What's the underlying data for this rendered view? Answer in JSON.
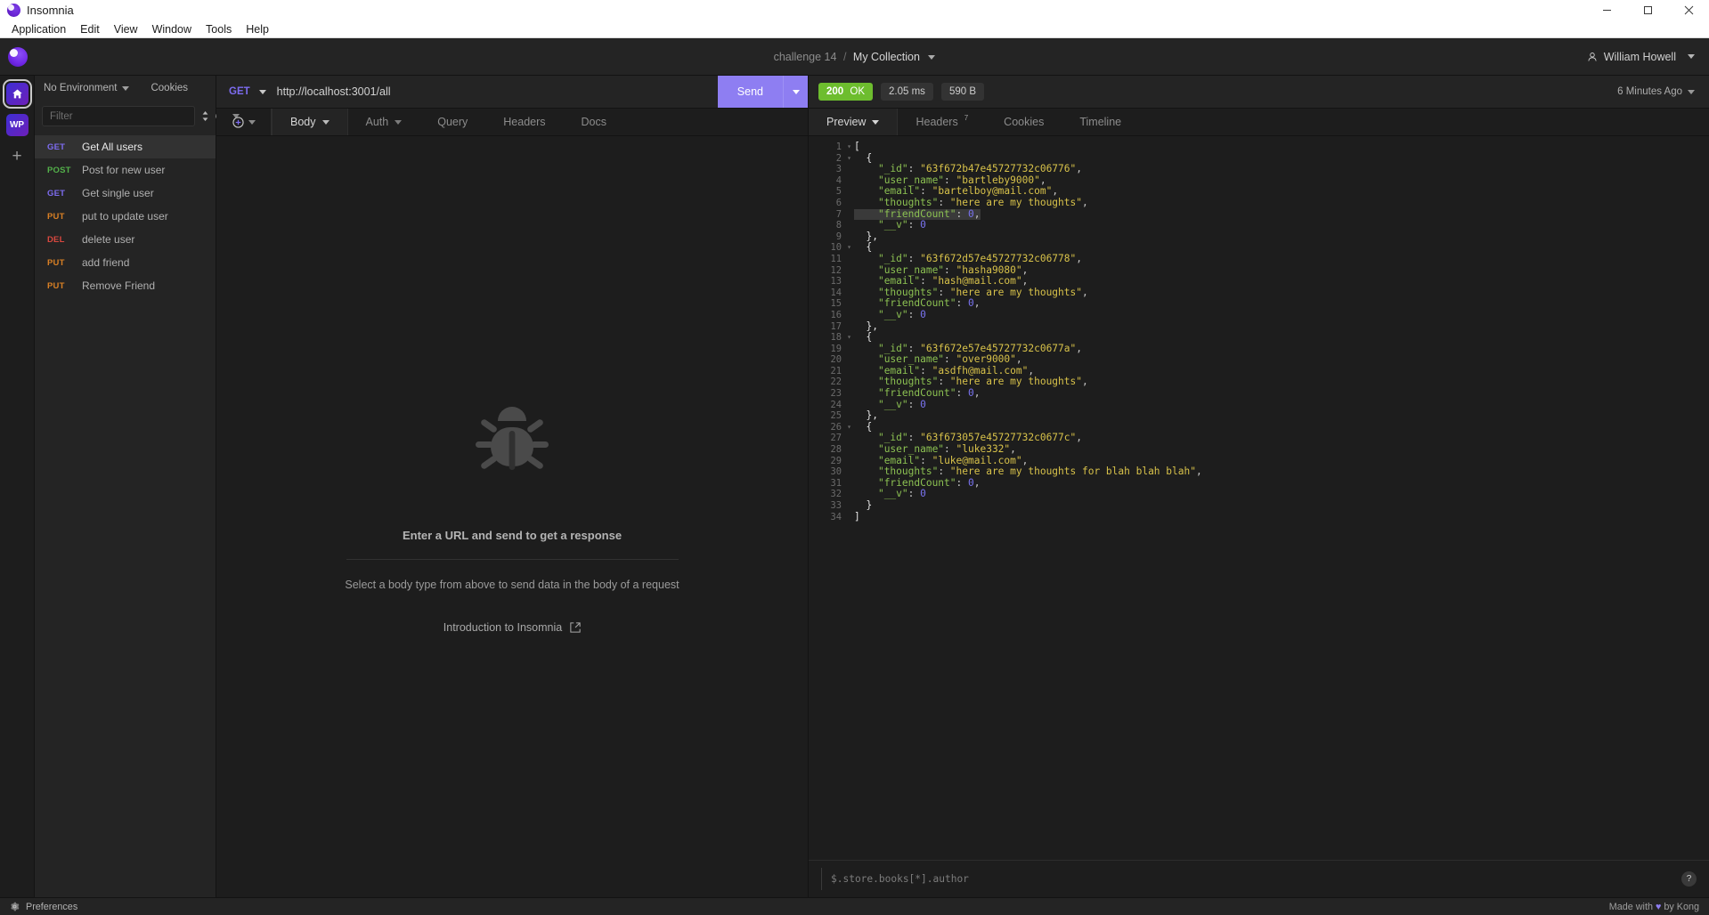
{
  "window": {
    "title": "Insomnia",
    "controls": {
      "minimize": "minimize-icon",
      "maximize": "maximize-icon",
      "close": "close-icon"
    }
  },
  "menubar": {
    "items": [
      "Application",
      "Edit",
      "View",
      "Window",
      "Tools",
      "Help"
    ]
  },
  "header": {
    "breadcrumb_project": "challenge 14",
    "breadcrumb_sep": "/",
    "breadcrumb_workspace": "My Collection",
    "user_name": "William Howell"
  },
  "rail": {
    "items": [
      {
        "name": "home",
        "label": "",
        "icon": "home-icon",
        "active": true
      },
      {
        "name": "wp",
        "label": "WP",
        "icon": "",
        "active": false
      }
    ],
    "add_label": "+"
  },
  "sidebar": {
    "environment": "No Environment",
    "cookies": "Cookies",
    "filter_placeholder": "Filter",
    "sort_icon": "sort-icon",
    "add_icon": "plus-circle-icon",
    "requests": [
      {
        "method": "GET",
        "name": "Get All users",
        "active": true
      },
      {
        "method": "POST",
        "name": "Post for new user",
        "active": false
      },
      {
        "method": "GET",
        "name": "Get single user",
        "active": false
      },
      {
        "method": "PUT",
        "name": "put to update user",
        "active": false
      },
      {
        "method": "DEL",
        "name": "delete user",
        "active": false
      },
      {
        "method": "PUT",
        "name": "add friend",
        "active": false
      },
      {
        "method": "PUT",
        "name": "Remove Friend",
        "active": false
      }
    ]
  },
  "request": {
    "method": "GET",
    "url": "http://localhost:3001/all",
    "send_label": "Send",
    "tabs": [
      {
        "label": "Body",
        "dropdown": true,
        "active": true
      },
      {
        "label": "Auth",
        "dropdown": true,
        "active": false
      },
      {
        "label": "Query",
        "dropdown": false,
        "active": false
      },
      {
        "label": "Headers",
        "dropdown": false,
        "active": false
      },
      {
        "label": "Docs",
        "dropdown": false,
        "active": false
      }
    ],
    "empty_state": {
      "icon": "bug-icon",
      "title": "Enter a URL and send to get a response",
      "subtitle": "Select a body type from above to send data in the body of a request",
      "link": "Introduction to Insomnia",
      "link_icon": "external-link-icon"
    }
  },
  "response": {
    "status": "200 OK",
    "status_code": "200",
    "status_text": "OK",
    "time": "2.05 ms",
    "size": "590 B",
    "time_ago": "6 Minutes Ago",
    "tabs": [
      {
        "label": "Preview",
        "dropdown": true,
        "badge": "",
        "active": true
      },
      {
        "label": "Headers",
        "dropdown": false,
        "badge": "7",
        "active": false
      },
      {
        "label": "Cookies",
        "dropdown": false,
        "badge": "",
        "active": false
      },
      {
        "label": "Timeline",
        "dropdown": false,
        "badge": "",
        "active": false
      }
    ],
    "filter_placeholder": "$.store.books[*].author",
    "help_icon": "question-mark-icon",
    "body_lines": [
      {
        "n": 1,
        "fold": "▾",
        "highlight": false,
        "tokens": [
          {
            "t": "[",
            "c": "b"
          }
        ]
      },
      {
        "n": 2,
        "fold": "▾",
        "highlight": false,
        "tokens": [
          {
            "t": "  {",
            "c": "b"
          }
        ]
      },
      {
        "n": 3,
        "fold": "",
        "highlight": false,
        "tokens": [
          {
            "t": "    ",
            "c": "p"
          },
          {
            "t": "\"_id\"",
            "c": "k"
          },
          {
            "t": ": ",
            "c": "p"
          },
          {
            "t": "\"63f672b47e45727732c06776\"",
            "c": "s"
          },
          {
            "t": ",",
            "c": "p"
          }
        ]
      },
      {
        "n": 4,
        "fold": "",
        "highlight": false,
        "tokens": [
          {
            "t": "    ",
            "c": "p"
          },
          {
            "t": "\"user_name\"",
            "c": "k"
          },
          {
            "t": ": ",
            "c": "p"
          },
          {
            "t": "\"bartleby9000\"",
            "c": "s"
          },
          {
            "t": ",",
            "c": "p"
          }
        ]
      },
      {
        "n": 5,
        "fold": "",
        "highlight": false,
        "tokens": [
          {
            "t": "    ",
            "c": "p"
          },
          {
            "t": "\"email\"",
            "c": "k"
          },
          {
            "t": ": ",
            "c": "p"
          },
          {
            "t": "\"bartelboy@mail.com\"",
            "c": "s"
          },
          {
            "t": ",",
            "c": "p"
          }
        ]
      },
      {
        "n": 6,
        "fold": "",
        "highlight": false,
        "tokens": [
          {
            "t": "    ",
            "c": "p"
          },
          {
            "t": "\"thoughts\"",
            "c": "k"
          },
          {
            "t": ": ",
            "c": "p"
          },
          {
            "t": "\"here are my thoughts\"",
            "c": "s"
          },
          {
            "t": ",",
            "c": "p"
          }
        ]
      },
      {
        "n": 7,
        "fold": "",
        "highlight": true,
        "tokens": [
          {
            "t": "    ",
            "c": "p"
          },
          {
            "t": "\"friendCount\"",
            "c": "k"
          },
          {
            "t": ": ",
            "c": "p"
          },
          {
            "t": "0",
            "c": "n"
          },
          {
            "t": ",",
            "c": "p"
          }
        ]
      },
      {
        "n": 8,
        "fold": "",
        "highlight": false,
        "tokens": [
          {
            "t": "    ",
            "c": "p"
          },
          {
            "t": "\"__v\"",
            "c": "k"
          },
          {
            "t": ": ",
            "c": "p"
          },
          {
            "t": "0",
            "c": "n"
          }
        ]
      },
      {
        "n": 9,
        "fold": "",
        "highlight": false,
        "tokens": [
          {
            "t": "  },",
            "c": "b"
          }
        ]
      },
      {
        "n": 10,
        "fold": "▾",
        "highlight": false,
        "tokens": [
          {
            "t": "  {",
            "c": "b"
          }
        ]
      },
      {
        "n": 11,
        "fold": "",
        "highlight": false,
        "tokens": [
          {
            "t": "    ",
            "c": "p"
          },
          {
            "t": "\"_id\"",
            "c": "k"
          },
          {
            "t": ": ",
            "c": "p"
          },
          {
            "t": "\"63f672d57e45727732c06778\"",
            "c": "s"
          },
          {
            "t": ",",
            "c": "p"
          }
        ]
      },
      {
        "n": 12,
        "fold": "",
        "highlight": false,
        "tokens": [
          {
            "t": "    ",
            "c": "p"
          },
          {
            "t": "\"user_name\"",
            "c": "k"
          },
          {
            "t": ": ",
            "c": "p"
          },
          {
            "t": "\"hasha9080\"",
            "c": "s"
          },
          {
            "t": ",",
            "c": "p"
          }
        ]
      },
      {
        "n": 13,
        "fold": "",
        "highlight": false,
        "tokens": [
          {
            "t": "    ",
            "c": "p"
          },
          {
            "t": "\"email\"",
            "c": "k"
          },
          {
            "t": ": ",
            "c": "p"
          },
          {
            "t": "\"hash@mail.com\"",
            "c": "s"
          },
          {
            "t": ",",
            "c": "p"
          }
        ]
      },
      {
        "n": 14,
        "fold": "",
        "highlight": false,
        "tokens": [
          {
            "t": "    ",
            "c": "p"
          },
          {
            "t": "\"thoughts\"",
            "c": "k"
          },
          {
            "t": ": ",
            "c": "p"
          },
          {
            "t": "\"here are my thoughts\"",
            "c": "s"
          },
          {
            "t": ",",
            "c": "p"
          }
        ]
      },
      {
        "n": 15,
        "fold": "",
        "highlight": false,
        "tokens": [
          {
            "t": "    ",
            "c": "p"
          },
          {
            "t": "\"friendCount\"",
            "c": "k"
          },
          {
            "t": ": ",
            "c": "p"
          },
          {
            "t": "0",
            "c": "n"
          },
          {
            "t": ",",
            "c": "p"
          }
        ]
      },
      {
        "n": 16,
        "fold": "",
        "highlight": false,
        "tokens": [
          {
            "t": "    ",
            "c": "p"
          },
          {
            "t": "\"__v\"",
            "c": "k"
          },
          {
            "t": ": ",
            "c": "p"
          },
          {
            "t": "0",
            "c": "n"
          }
        ]
      },
      {
        "n": 17,
        "fold": "",
        "highlight": false,
        "tokens": [
          {
            "t": "  },",
            "c": "b"
          }
        ]
      },
      {
        "n": 18,
        "fold": "▾",
        "highlight": false,
        "tokens": [
          {
            "t": "  {",
            "c": "b"
          }
        ]
      },
      {
        "n": 19,
        "fold": "",
        "highlight": false,
        "tokens": [
          {
            "t": "    ",
            "c": "p"
          },
          {
            "t": "\"_id\"",
            "c": "k"
          },
          {
            "t": ": ",
            "c": "p"
          },
          {
            "t": "\"63f672e57e45727732c0677a\"",
            "c": "s"
          },
          {
            "t": ",",
            "c": "p"
          }
        ]
      },
      {
        "n": 20,
        "fold": "",
        "highlight": false,
        "tokens": [
          {
            "t": "    ",
            "c": "p"
          },
          {
            "t": "\"user_name\"",
            "c": "k"
          },
          {
            "t": ": ",
            "c": "p"
          },
          {
            "t": "\"over9000\"",
            "c": "s"
          },
          {
            "t": ",",
            "c": "p"
          }
        ]
      },
      {
        "n": 21,
        "fold": "",
        "highlight": false,
        "tokens": [
          {
            "t": "    ",
            "c": "p"
          },
          {
            "t": "\"email\"",
            "c": "k"
          },
          {
            "t": ": ",
            "c": "p"
          },
          {
            "t": "\"asdfh@mail.com\"",
            "c": "s"
          },
          {
            "t": ",",
            "c": "p"
          }
        ]
      },
      {
        "n": 22,
        "fold": "",
        "highlight": false,
        "tokens": [
          {
            "t": "    ",
            "c": "p"
          },
          {
            "t": "\"thoughts\"",
            "c": "k"
          },
          {
            "t": ": ",
            "c": "p"
          },
          {
            "t": "\"here are my thoughts\"",
            "c": "s"
          },
          {
            "t": ",",
            "c": "p"
          }
        ]
      },
      {
        "n": 23,
        "fold": "",
        "highlight": false,
        "tokens": [
          {
            "t": "    ",
            "c": "p"
          },
          {
            "t": "\"friendCount\"",
            "c": "k"
          },
          {
            "t": ": ",
            "c": "p"
          },
          {
            "t": "0",
            "c": "n"
          },
          {
            "t": ",",
            "c": "p"
          }
        ]
      },
      {
        "n": 24,
        "fold": "",
        "highlight": false,
        "tokens": [
          {
            "t": "    ",
            "c": "p"
          },
          {
            "t": "\"__v\"",
            "c": "k"
          },
          {
            "t": ": ",
            "c": "p"
          },
          {
            "t": "0",
            "c": "n"
          }
        ]
      },
      {
        "n": 25,
        "fold": "",
        "highlight": false,
        "tokens": [
          {
            "t": "  },",
            "c": "b"
          }
        ]
      },
      {
        "n": 26,
        "fold": "▾",
        "highlight": false,
        "tokens": [
          {
            "t": "  {",
            "c": "b"
          }
        ]
      },
      {
        "n": 27,
        "fold": "",
        "highlight": false,
        "tokens": [
          {
            "t": "    ",
            "c": "p"
          },
          {
            "t": "\"_id\"",
            "c": "k"
          },
          {
            "t": ": ",
            "c": "p"
          },
          {
            "t": "\"63f673057e45727732c0677c\"",
            "c": "s"
          },
          {
            "t": ",",
            "c": "p"
          }
        ]
      },
      {
        "n": 28,
        "fold": "",
        "highlight": false,
        "tokens": [
          {
            "t": "    ",
            "c": "p"
          },
          {
            "t": "\"user_name\"",
            "c": "k"
          },
          {
            "t": ": ",
            "c": "p"
          },
          {
            "t": "\"luke332\"",
            "c": "s"
          },
          {
            "t": ",",
            "c": "p"
          }
        ]
      },
      {
        "n": 29,
        "fold": "",
        "highlight": false,
        "tokens": [
          {
            "t": "    ",
            "c": "p"
          },
          {
            "t": "\"email\"",
            "c": "k"
          },
          {
            "t": ": ",
            "c": "p"
          },
          {
            "t": "\"luke@mail.com\"",
            "c": "s"
          },
          {
            "t": ",",
            "c": "p"
          }
        ]
      },
      {
        "n": 30,
        "fold": "",
        "highlight": false,
        "tokens": [
          {
            "t": "    ",
            "c": "p"
          },
          {
            "t": "\"thoughts\"",
            "c": "k"
          },
          {
            "t": ": ",
            "c": "p"
          },
          {
            "t": "\"here are my thoughts for blah blah blah\"",
            "c": "s"
          },
          {
            "t": ",",
            "c": "p"
          }
        ]
      },
      {
        "n": 31,
        "fold": "",
        "highlight": false,
        "tokens": [
          {
            "t": "    ",
            "c": "p"
          },
          {
            "t": "\"friendCount\"",
            "c": "k"
          },
          {
            "t": ": ",
            "c": "p"
          },
          {
            "t": "0",
            "c": "n"
          },
          {
            "t": ",",
            "c": "p"
          }
        ]
      },
      {
        "n": 32,
        "fold": "",
        "highlight": false,
        "tokens": [
          {
            "t": "    ",
            "c": "p"
          },
          {
            "t": "\"__v\"",
            "c": "k"
          },
          {
            "t": ": ",
            "c": "p"
          },
          {
            "t": "0",
            "c": "n"
          }
        ]
      },
      {
        "n": 33,
        "fold": "",
        "highlight": false,
        "tokens": [
          {
            "t": "  }",
            "c": "b"
          }
        ]
      },
      {
        "n": 34,
        "fold": "",
        "highlight": false,
        "tokens": [
          {
            "t": "]",
            "c": "b"
          }
        ]
      }
    ]
  },
  "statusbar": {
    "preferences": "Preferences",
    "made_prefix": "Made with",
    "made_suffix": "by Kong",
    "heart": "♥"
  },
  "colors": {
    "accent": "#8e7ef2",
    "status_ok": "#6dbd2e",
    "method_get": "#7d6cf0",
    "method_post": "#53b04a",
    "method_put": "#d98024",
    "method_del": "#d9483f"
  }
}
